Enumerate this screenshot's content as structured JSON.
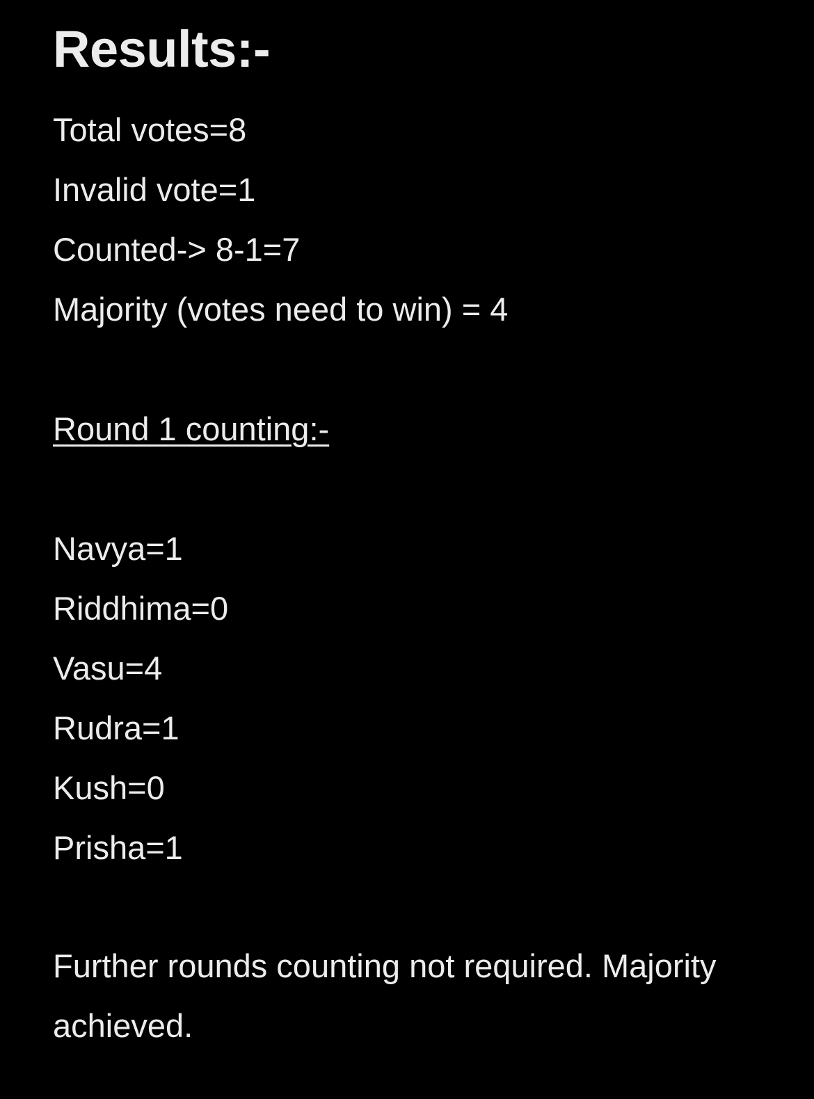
{
  "note": {
    "title": "Results:-",
    "summary": {
      "total_votes": "Total votes=8",
      "invalid_vote": "Invalid vote=1",
      "counted": "Counted-> 8-1=7",
      "majority": "Majority (votes need to win) = 4"
    },
    "round_heading": "Round 1 counting:-",
    "tallies": [
      {
        "text": "Navya=1"
      },
      {
        "text": "Riddhima=0"
      },
      {
        "text": "Vasu=4"
      },
      {
        "text": "Rudra=1"
      },
      {
        "text": "Kush=0"
      },
      {
        "text": "Prisha=1"
      }
    ],
    "conclusion": "Further rounds counting not required. Majority achieved."
  }
}
